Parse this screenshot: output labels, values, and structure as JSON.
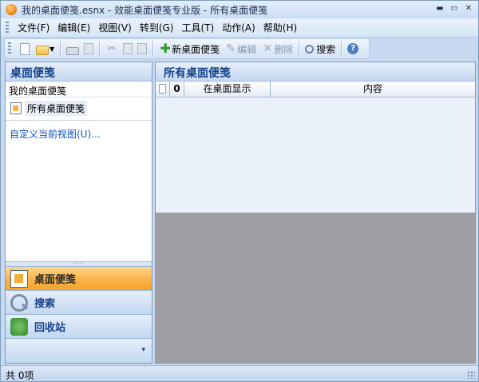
{
  "window": {
    "title": "我的桌面便笺.esnx - 效能桌面便笺专业版 - 所有桌面便笺",
    "minimize": "▬",
    "maximize": "▭",
    "close": "✕"
  },
  "menu": {
    "items": [
      "文件(F)",
      "编辑(E)",
      "视图(V)",
      "转到(G)",
      "工具(T)",
      "动作(A)",
      "帮助(H)"
    ]
  },
  "toolbar": {
    "new_note_label": "新桌面便笺",
    "edit_label": "编辑",
    "delete_label": "删除",
    "search_label": "搜索"
  },
  "left_panel": {
    "header": "桌面便笺",
    "group_title": "我的桌面便笺",
    "tree_item": "所有桌面便笺",
    "custom_view": "自定义当前视图(U)...",
    "splitter_dots": "·····",
    "nav": {
      "notes": "桌面便笺",
      "search": "搜索",
      "recycle": "回收站"
    }
  },
  "right_panel": {
    "header": "所有桌面便笺",
    "columns": {
      "attachment": "0",
      "show_on_desktop": "在桌面显示",
      "content": "内容"
    },
    "scroll_thumb_grip": "|||"
  },
  "status": {
    "text": "共 0项"
  },
  "colors": {
    "accent_header": "#15428b",
    "active_nav": "#f9b54d",
    "detail_bg": "#9e9ea3"
  }
}
